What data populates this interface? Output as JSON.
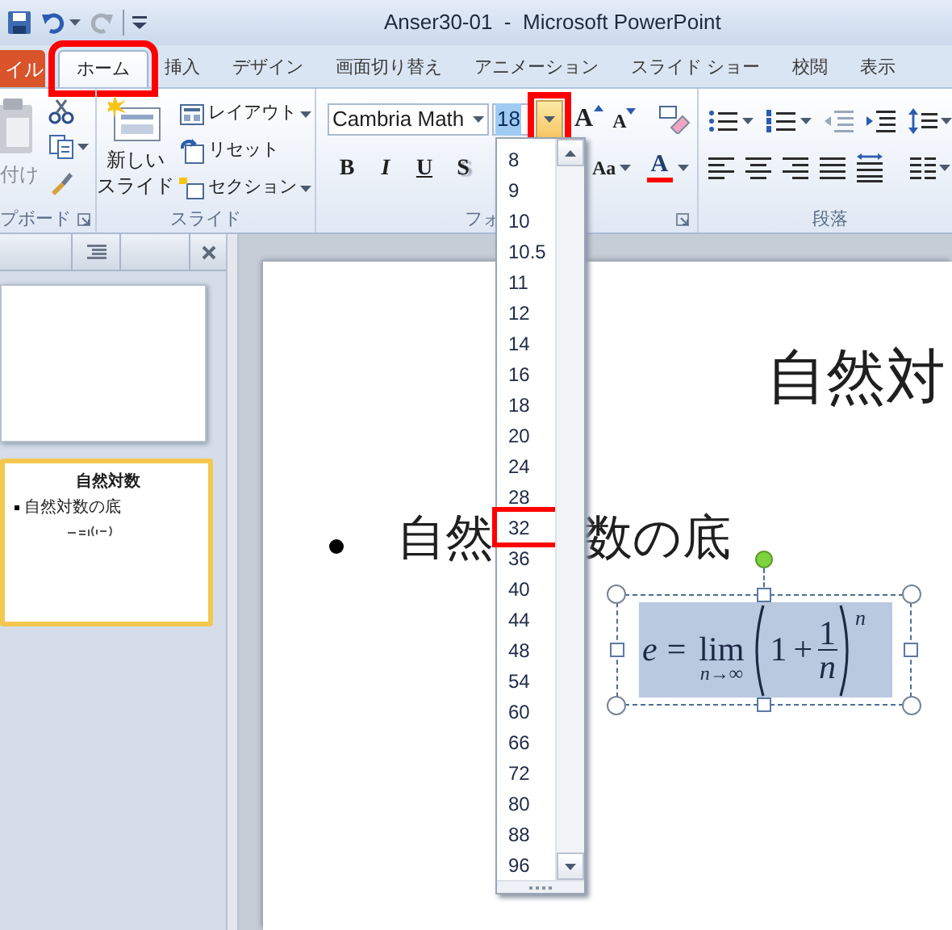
{
  "window": {
    "title": "Anser30-01  -  Microsoft PowerPoint"
  },
  "tabs": [
    {
      "label": "イル",
      "kind": "file",
      "selected": false,
      "highlighted": false
    },
    {
      "label": "ホーム",
      "kind": "tab",
      "selected": true,
      "highlighted": true
    },
    {
      "label": "挿入",
      "kind": "tab",
      "selected": false,
      "highlighted": false
    },
    {
      "label": "デザイン",
      "kind": "tab",
      "selected": false,
      "highlighted": false
    },
    {
      "label": "画面切り替え",
      "kind": "tab",
      "selected": false,
      "highlighted": false
    },
    {
      "label": "アニメーション",
      "kind": "tab",
      "selected": false,
      "highlighted": false
    },
    {
      "label": "スライド ショー",
      "kind": "tab",
      "selected": false,
      "highlighted": false
    },
    {
      "label": "校閲",
      "kind": "tab",
      "selected": false,
      "highlighted": false
    },
    {
      "label": "表示",
      "kind": "tab",
      "selected": false,
      "highlighted": false
    }
  ],
  "clipboard_group": {
    "paste_label": "付け",
    "label": "プボード"
  },
  "slides_group": {
    "new_slide": [
      "新しい",
      "スライド"
    ],
    "commands": [
      {
        "label": "レイアウト",
        "kind": "layout",
        "has_menu": true
      },
      {
        "label": "リセット",
        "kind": "reset",
        "has_menu": false
      },
      {
        "label": "セクション",
        "kind": "section",
        "has_menu": true
      }
    ],
    "label": "スライド"
  },
  "font_group": {
    "font_name": "Cambria Math",
    "font_size": "18",
    "size_button_highlighted": true,
    "grow": "A",
    "shrink": "A",
    "styles": [
      {
        "label": "B",
        "kind": "bold"
      },
      {
        "label": "I",
        "kind": "italic"
      },
      {
        "label": "U",
        "kind": "underline"
      },
      {
        "label": "S",
        "kind": "shadow"
      }
    ],
    "change_case": "Aa",
    "font_color": "A",
    "label": "フォ"
  },
  "paragraph_group": {
    "label": "段落"
  },
  "slide_thumbnails": [
    {
      "selected": false
    },
    {
      "selected": true,
      "title": "自然対数",
      "bullet": "自然対数の底"
    }
  ],
  "slide": {
    "title": "自然対",
    "bullet_parts": [
      "自然",
      "数の底"
    ],
    "equation": {
      "selected": true,
      "lhs": "e",
      "relation": "=",
      "operator": "lim",
      "limit": "n→∞",
      "term": "1",
      "plus": "+",
      "numerator": "1",
      "denominator": "n",
      "exponent": "n"
    }
  },
  "size_list": [
    {
      "label": "8",
      "highlighted": false
    },
    {
      "label": "9",
      "highlighted": false
    },
    {
      "label": "10",
      "highlighted": false
    },
    {
      "label": "10.5",
      "highlighted": false
    },
    {
      "label": "11",
      "highlighted": false
    },
    {
      "label": "12",
      "highlighted": false
    },
    {
      "label": "14",
      "highlighted": false
    },
    {
      "label": "16",
      "highlighted": false
    },
    {
      "label": "18",
      "highlighted": false
    },
    {
      "label": "20",
      "highlighted": false
    },
    {
      "label": "24",
      "highlighted": false
    },
    {
      "label": "28",
      "highlighted": false
    },
    {
      "label": "32",
      "highlighted": true
    },
    {
      "label": "36",
      "highlighted": false
    },
    {
      "label": "40",
      "highlighted": false
    },
    {
      "label": "44",
      "highlighted": false
    },
    {
      "label": "48",
      "highlighted": false
    },
    {
      "label": "54",
      "highlighted": false
    },
    {
      "label": "60",
      "highlighted": false
    },
    {
      "label": "66",
      "highlighted": false
    },
    {
      "label": "72",
      "highlighted": false
    },
    {
      "label": "80",
      "highlighted": false
    },
    {
      "label": "88",
      "highlighted": false
    },
    {
      "label": "96",
      "highlighted": false
    }
  ]
}
